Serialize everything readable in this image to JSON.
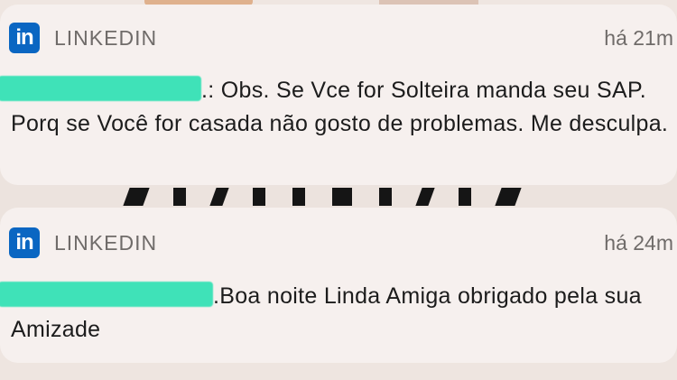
{
  "notifications": [
    {
      "app_icon_text": "in",
      "app_name": "LINKEDIN",
      "time": "há 21m",
      "sender_redacted": ".",
      "message": ": Obs. Se Vce for Solteira manda seu SAP. Porq se Você for casada não gosto de problemas. Me desculpa."
    },
    {
      "app_icon_text": "in",
      "app_name": "LINKEDIN",
      "time": "há 24m",
      "sender_redacted": ".",
      "message": "Boa noite Linda Amiga obrigado pela sua Amizade"
    }
  ],
  "colors": {
    "linkedin_blue": "#0a66c2",
    "redaction_marker": "#3fe2b8"
  }
}
